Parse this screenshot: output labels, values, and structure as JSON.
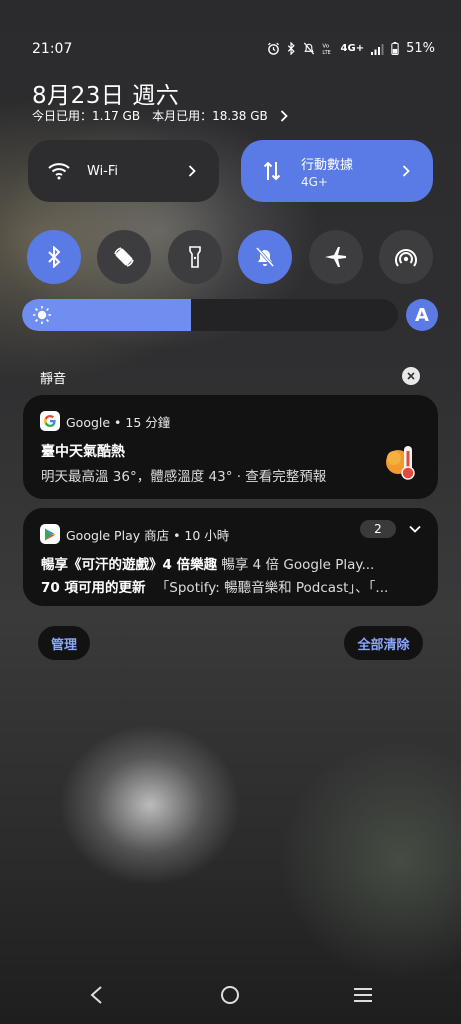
{
  "status_bar": {
    "time": "21:07",
    "network": "4G+",
    "battery": "51%"
  },
  "header": {
    "date": "8月23日 週六",
    "data_today": "今日已用：1.17 GB",
    "data_month": "本月已用：18.38 GB"
  },
  "tiles": {
    "wifi": {
      "label": "Wi-Fi"
    },
    "mobile_data": {
      "label": "行動數據",
      "sub": "4G+"
    }
  },
  "toggles": [
    {
      "icon": "bluetooth-icon",
      "on": true
    },
    {
      "icon": "auto-rotate-icon",
      "on": false
    },
    {
      "icon": "flashlight-icon",
      "on": false
    },
    {
      "icon": "mute-bell-icon",
      "on": true
    },
    {
      "icon": "airplane-icon",
      "on": false
    },
    {
      "icon": "hotspot-icon",
      "on": false
    }
  ],
  "brightness": {
    "level": 0.45,
    "auto_label": "A"
  },
  "section": {
    "title": "靜音"
  },
  "notifications": [
    {
      "app": "Google • 15 分鐘",
      "title": "臺中天氣酷熱",
      "body": "明天最高溫 36°，體感溫度 43° · 查看完整預報"
    },
    {
      "app": "Google Play 商店 • 10 小時",
      "count": "2",
      "title_1": "暢享《可汗的遊戲》4 倍樂趣",
      "body_1": "暢享 4 倍 Google Play...",
      "title_2": "70 項可用的更新",
      "body_2": "「Spotify: 暢聽音樂和 Podcast」、「..."
    }
  ],
  "actions": {
    "manage": "管理",
    "clear_all": "全部清除"
  },
  "colors": {
    "accent": "#5a7be6",
    "link": "#8aa6ff"
  }
}
